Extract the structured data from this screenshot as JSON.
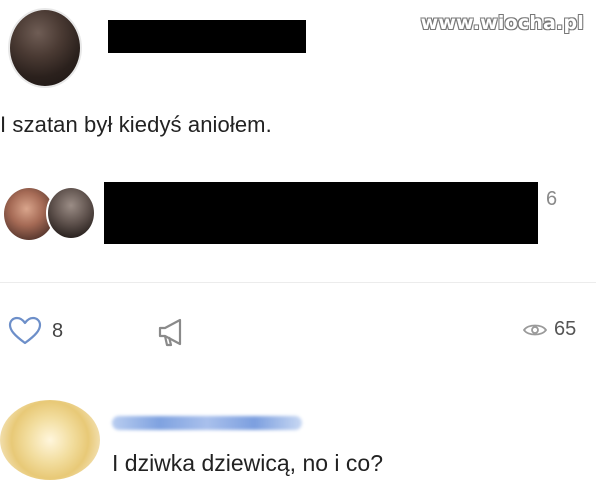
{
  "watermark": "www.wiocha.pl",
  "post": {
    "text": "I szatan był kiedyś aniołem."
  },
  "liked_by": {
    "count": "6"
  },
  "actions": {
    "likes_count": "8",
    "views_count": "65"
  },
  "comment": {
    "text": "I dziwka dziewicą, no i co?"
  },
  "icons": {
    "like": "heart-outline-icon",
    "share": "megaphone-icon",
    "views": "eye-icon"
  },
  "colors": {
    "text": "#222222",
    "muted": "#8a8a8a",
    "redaction": "#000000",
    "blurred_name": "#7fa2e0"
  }
}
